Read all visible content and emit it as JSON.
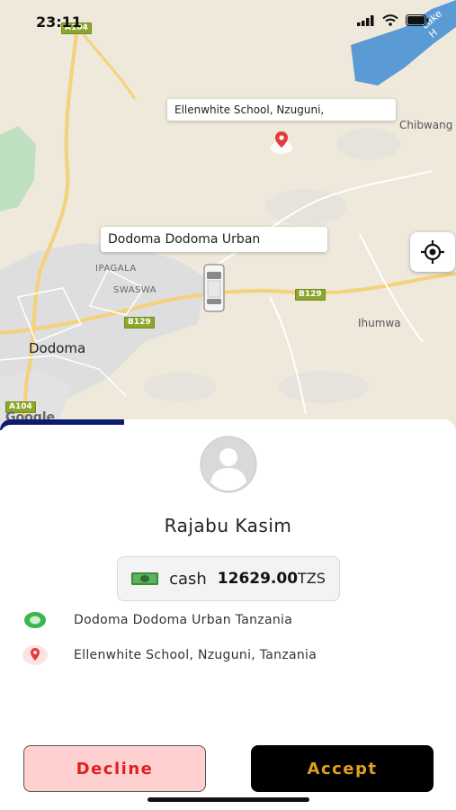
{
  "status": {
    "time": "23:11"
  },
  "map": {
    "labels": {
      "lake": "Lake H",
      "chibwang": "Chibwang",
      "ipagala": "IPAGALA",
      "swaswa": "SWASWA",
      "ihumwa": "Ihumwa",
      "dodoma": "Dodoma",
      "google": "Google"
    },
    "roads": {
      "a104_top": "A104",
      "a104_bottom": "A104",
      "b129_left": "B129",
      "b129_right": "B129"
    },
    "callouts": {
      "destination": "Ellenwhite School, Nzuguni,",
      "origin": "Dodoma Dodoma Urban"
    },
    "icons": {
      "pin": "destination-pin-icon",
      "car": "vehicle-icon",
      "locate": "my-location-icon"
    }
  },
  "ride": {
    "rider_name": "Rajabu Kasim",
    "payment_method": "cash",
    "fare_amount": "12629.00",
    "currency": "TZS",
    "pickup": "Dodoma Dodoma Urban Tanzania",
    "dropoff": "Ellenwhite School, Nzuguni, Tanzania"
  },
  "actions": {
    "decline": "Decline",
    "accept": "Accept"
  },
  "colors": {
    "decline_bg": "#ffd0d0",
    "decline_text": "#e02020",
    "accept_bg": "#000000",
    "accept_text": "#e0a020",
    "pickup_icon": "#3cb54a",
    "dropoff_icon": "#e23c3c",
    "sheet_accent": "#0d1b6e"
  }
}
